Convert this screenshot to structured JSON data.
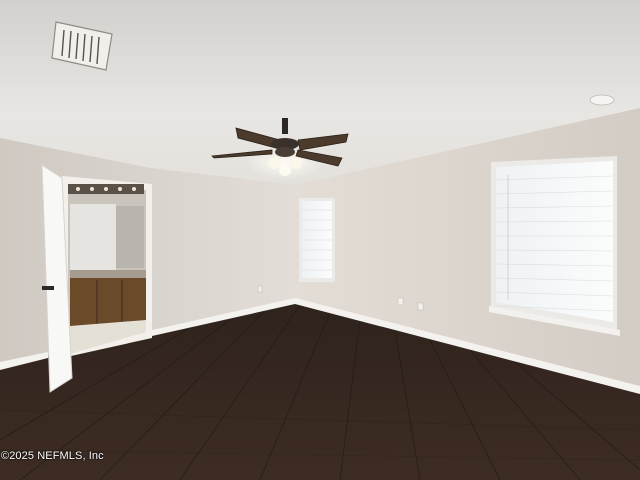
{
  "photo": {
    "watermark": "©2025 NEFMLS, Inc",
    "colors": {
      "ceiling": "#e6e4e1",
      "wall_left": "#d8d2cc",
      "wall_right": "#ddd7d0",
      "floor": "#3a2a22",
      "baseboard": "#f3f1ee",
      "window_blind": "#f5f7f8",
      "cabinet": "#6b4a2a"
    }
  }
}
